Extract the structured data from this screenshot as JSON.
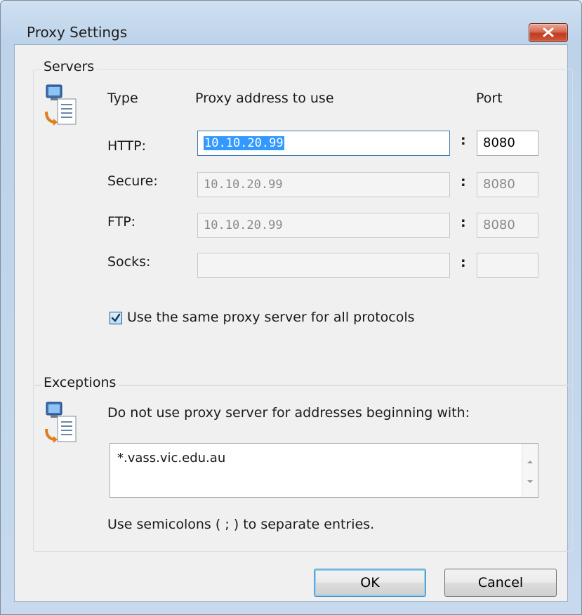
{
  "window": {
    "title": "Proxy Settings"
  },
  "servers": {
    "group_title": "Servers",
    "col_type": "Type",
    "col_address": "Proxy address to use",
    "col_port": "Port",
    "colon": ":",
    "rows": [
      {
        "label": "HTTP:",
        "address": "10.10.20.99",
        "port": "8080",
        "enabled": true
      },
      {
        "label": "Secure:",
        "address": "10.10.20.99",
        "port": "8080",
        "enabled": false
      },
      {
        "label": "FTP:",
        "address": "10.10.20.99",
        "port": "8080",
        "enabled": false
      },
      {
        "label": "Socks:",
        "address": "",
        "port": "",
        "enabled": false
      }
    ],
    "same_proxy_label": "Use the same proxy server for all protocols",
    "same_proxy_checked": true
  },
  "exceptions": {
    "group_title": "Exceptions",
    "description": "Do not use proxy server for addresses beginning with:",
    "value": "*.vass.vic.edu.au",
    "hint": "Use semicolons ( ; ) to separate entries."
  },
  "buttons": {
    "ok": "OK",
    "cancel": "Cancel"
  },
  "icons": {
    "servers": "network-computer-icon",
    "exceptions": "network-computer-icon",
    "close": "close-icon"
  },
  "colors": {
    "selection": "#3399ff",
    "close_button": "#c13b1f",
    "default_button_border": "#3c7fb1"
  }
}
